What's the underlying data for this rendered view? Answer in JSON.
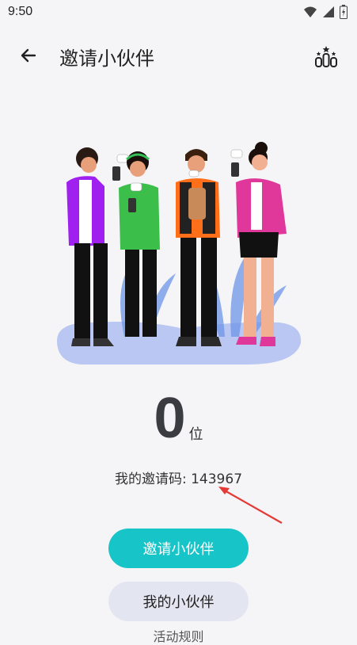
{
  "status_bar": {
    "time": "9:50",
    "icons": [
      "wifi-icon",
      "signal-icon",
      "battery-icon"
    ]
  },
  "app_bar": {
    "title": "邀请小伙伴",
    "back_icon": "back-arrow-icon",
    "rank_icon": "ranking-icon"
  },
  "stats": {
    "count": "0",
    "unit": "位"
  },
  "invite_code": {
    "label": "我的邀请码: ",
    "value": "143967"
  },
  "actions": {
    "invite_label": "邀请小伙伴",
    "partners_label": "我的小伙伴",
    "rules_label": "活动规则"
  },
  "colors": {
    "accent": "#17c5c8",
    "secondary_button": "#e3e6f1",
    "annotation_arrow": "#e53935"
  }
}
